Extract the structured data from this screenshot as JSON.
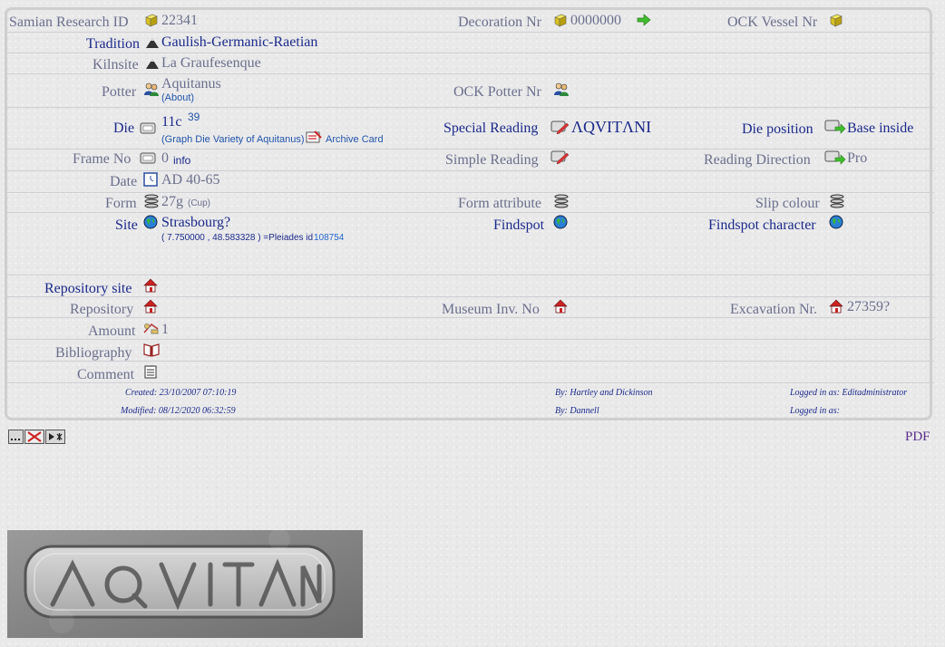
{
  "record": {
    "samian_id_label": "Samian Research ID",
    "samian_id_value": "22341",
    "decoration_label": "Decoration Nr",
    "decoration_value": "0000000",
    "ock_vessel_label": "OCK Vessel Nr",
    "tradition_label": "Tradition",
    "tradition_value": "Gaulish-Germanic-Raetian",
    "kilnsite_label": "Kilnsite",
    "kilnsite_value": "La Graufesenque",
    "potter_label": "Potter",
    "potter_value": "Aquitanus",
    "potter_about": "(About)",
    "ock_potter_label": "OCK Potter Nr",
    "die_label": "Die",
    "die_value": "11c",
    "die_sup": "39",
    "die_variety": "(Graph Die Variety of Aquitanus)",
    "archive_card": "Archive Card",
    "special_reading_label": "Special Reading",
    "special_reading_value": "ΛQVITΛNI",
    "die_position_label": "Die position",
    "die_position_value": "Base inside",
    "frame_label": "Frame No",
    "frame_value": "0",
    "frame_info": "info",
    "simple_reading_label": "Simple Reading",
    "reading_direction_label": "Reading Direction",
    "reading_direction_value": "Pro",
    "date_label": "Date",
    "date_value": "AD 40-65",
    "form_label": "Form",
    "form_value": "27g",
    "form_sub": "(Cup)",
    "form_attr_label": "Form attribute",
    "slip_label": "Slip colour",
    "site_label": "Site",
    "site_value": "Strasbourg?",
    "site_coords": "( 7.750000 , 48.583328 ) =Pleiades id",
    "site_pleiades": "108754",
    "findspot_label": "Findspot",
    "findspot_char_label": "Findspot character",
    "repo_site_label": "Repository site",
    "repository_label": "Repository",
    "museum_label": "Museum Inv. No",
    "excavation_label": "Excavation Nr.",
    "excavation_value": "27359?",
    "amount_label": "Amount",
    "amount_value": "1",
    "bibliography_label": "Bibliography",
    "comment_label": "Comment"
  },
  "meta": {
    "created": "Created: 23/10/2007 07:10:19",
    "created_by": "By: Hartley and Dickinson",
    "created_logged": "Logged in as: Editadministrator",
    "modified": "Modified: 08/12/2020 06:32:59",
    "modified_by": "By: Dannell",
    "modified_logged": "Logged in as:"
  },
  "toolbar": {
    "pdf": "PDF"
  },
  "colors": {
    "label": "#6b6f8c",
    "label_dark": "#1b2a8a",
    "link": "#2266cc",
    "pdf": "#5a2a8a"
  },
  "icons": [
    "gold-box-icon",
    "arrow-right-icon",
    "mountain-icon",
    "people-icon",
    "card-icon",
    "pencil-card-icon",
    "card-arrow-icon",
    "calendar-icon",
    "pottery-icon",
    "globe-icon",
    "house-icon",
    "coins-icon",
    "book-icon",
    "notepad-icon"
  ]
}
